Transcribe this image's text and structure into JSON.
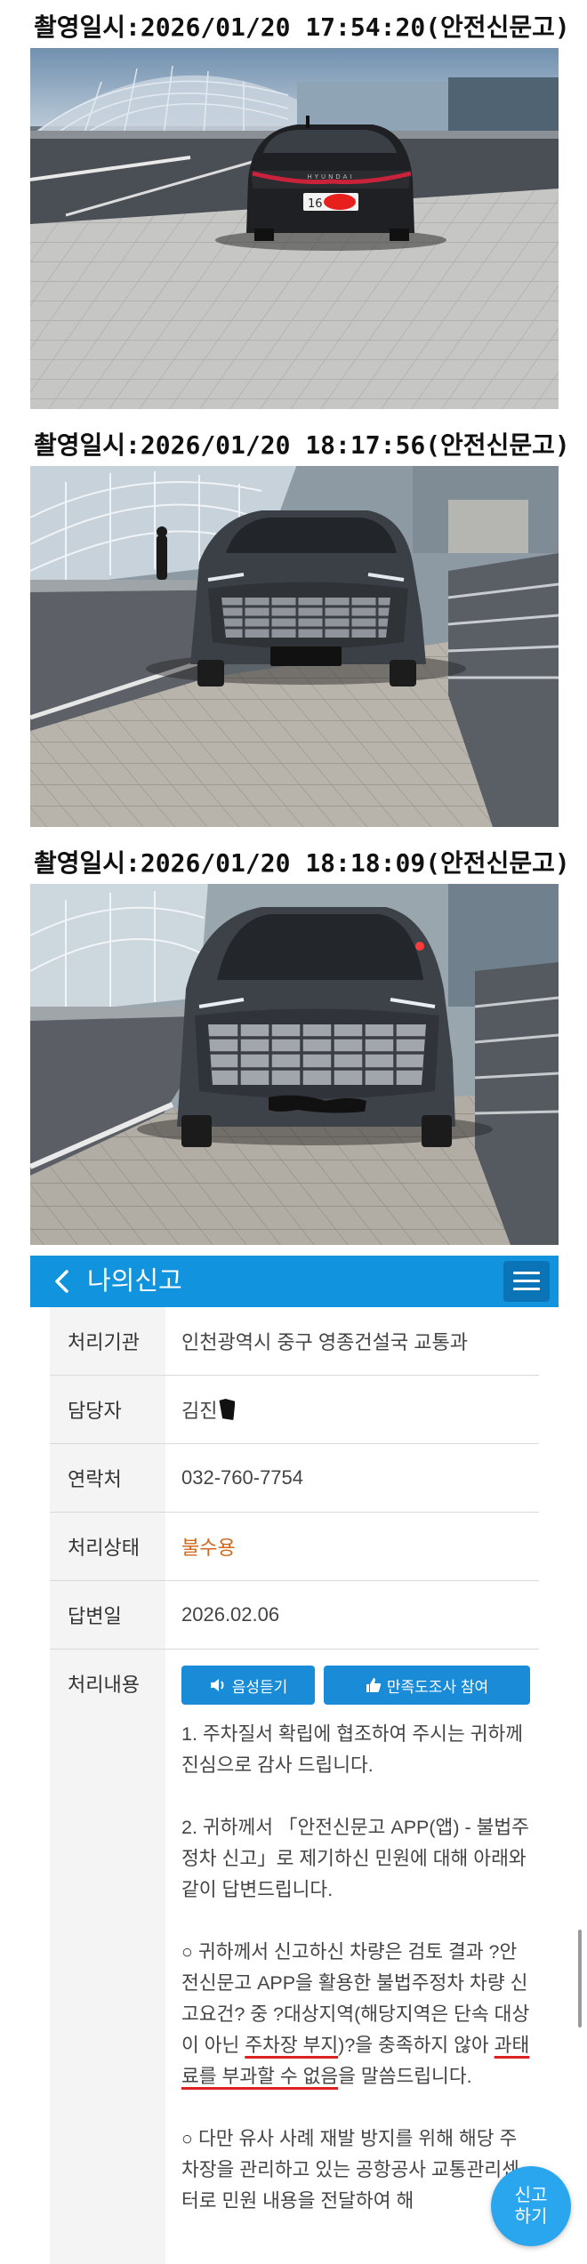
{
  "photos": [
    {
      "timestamp": "촬영일시:2026/01/20 17:54:20(안전신문고)",
      "plate_text": "16"
    },
    {
      "timestamp": "촬영일시:2026/01/20 18:17:56(안전신문고)"
    },
    {
      "timestamp": "촬영일시:2026/01/20 18:18:09(안전신문고)"
    }
  ],
  "app": {
    "title": "나의신고",
    "rows": [
      {
        "label": "처리기관",
        "value": "인천광역시 중구 영종건설국 교통과"
      },
      {
        "label": "담당자",
        "value": "김진"
      },
      {
        "label": "연락처",
        "value": "032-760-7754"
      },
      {
        "label": "처리상태",
        "value": "불수용"
      },
      {
        "label": "답변일",
        "value": "2026.02.06"
      },
      {
        "label": "처리내용"
      }
    ],
    "buttons": {
      "listen": "음성듣기",
      "survey": "만족도조사 참여"
    },
    "reply": {
      "p1": "1. 주차질서 확립에 협조하여 주시는 귀하께 진심으로 감사 드립니다.",
      "p2": "2. 귀하께서 「안전신문고 APP(앱) - 불법주정차 신고」로 제기하신 민원에 대해 아래와 같이 답변드립니다.",
      "p3a": "○ 귀하께서 신고하신 차량은 검토 결과 ?안전신문고 APP을 활용한 불법주정차 차량 신고요건? 중 ?대상지역(해당지역은 단속 대상이 아닌 ",
      "p3b": "주차장 부지",
      "p3c": ")?을 충족하지 않아 ",
      "p3d": "과태료를 부과할 수 없음",
      "p3e": "을 말씀드립니다.",
      "p4": "○ 다만 유사 사례 재발 방지를 위해 해당 주차장을 관리하고 있는 공항공사 교통관리센터로 민원 내용을 전달하여 해"
    },
    "fab_label": "신고하기"
  }
}
